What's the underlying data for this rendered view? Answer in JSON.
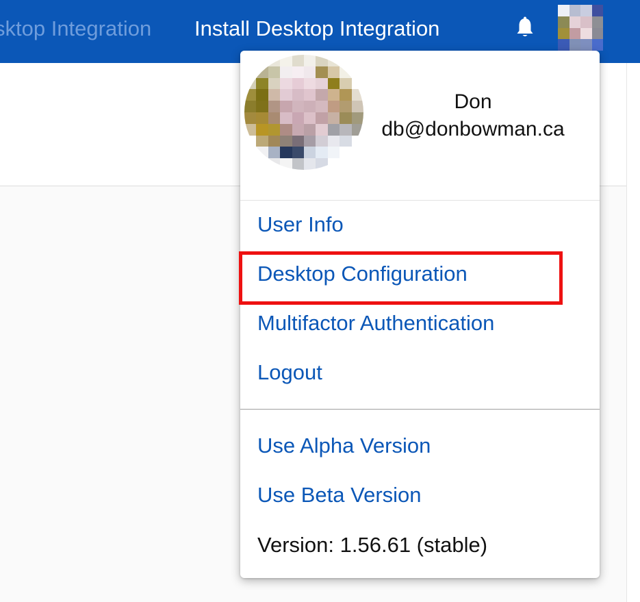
{
  "topbar": {
    "faded_link": "sktop Integration",
    "install_link": "Install Desktop Integration",
    "bell_icon": "bell-icon",
    "avatar_icon": "user-avatar"
  },
  "menu": {
    "profile": {
      "name": "Don",
      "email": "db@donbowman.ca",
      "avatar_icon": "user-avatar"
    },
    "items": [
      "User Info",
      "Desktop Configuration",
      "Multifactor Authentication",
      "Logout"
    ],
    "version_items": [
      "Use Alpha Version",
      "Use Beta Version"
    ],
    "version_text": "Version: 1.56.61 (stable)"
  },
  "colors": {
    "brand_blue": "#0b57b7",
    "highlight_red": "#ee1111"
  }
}
